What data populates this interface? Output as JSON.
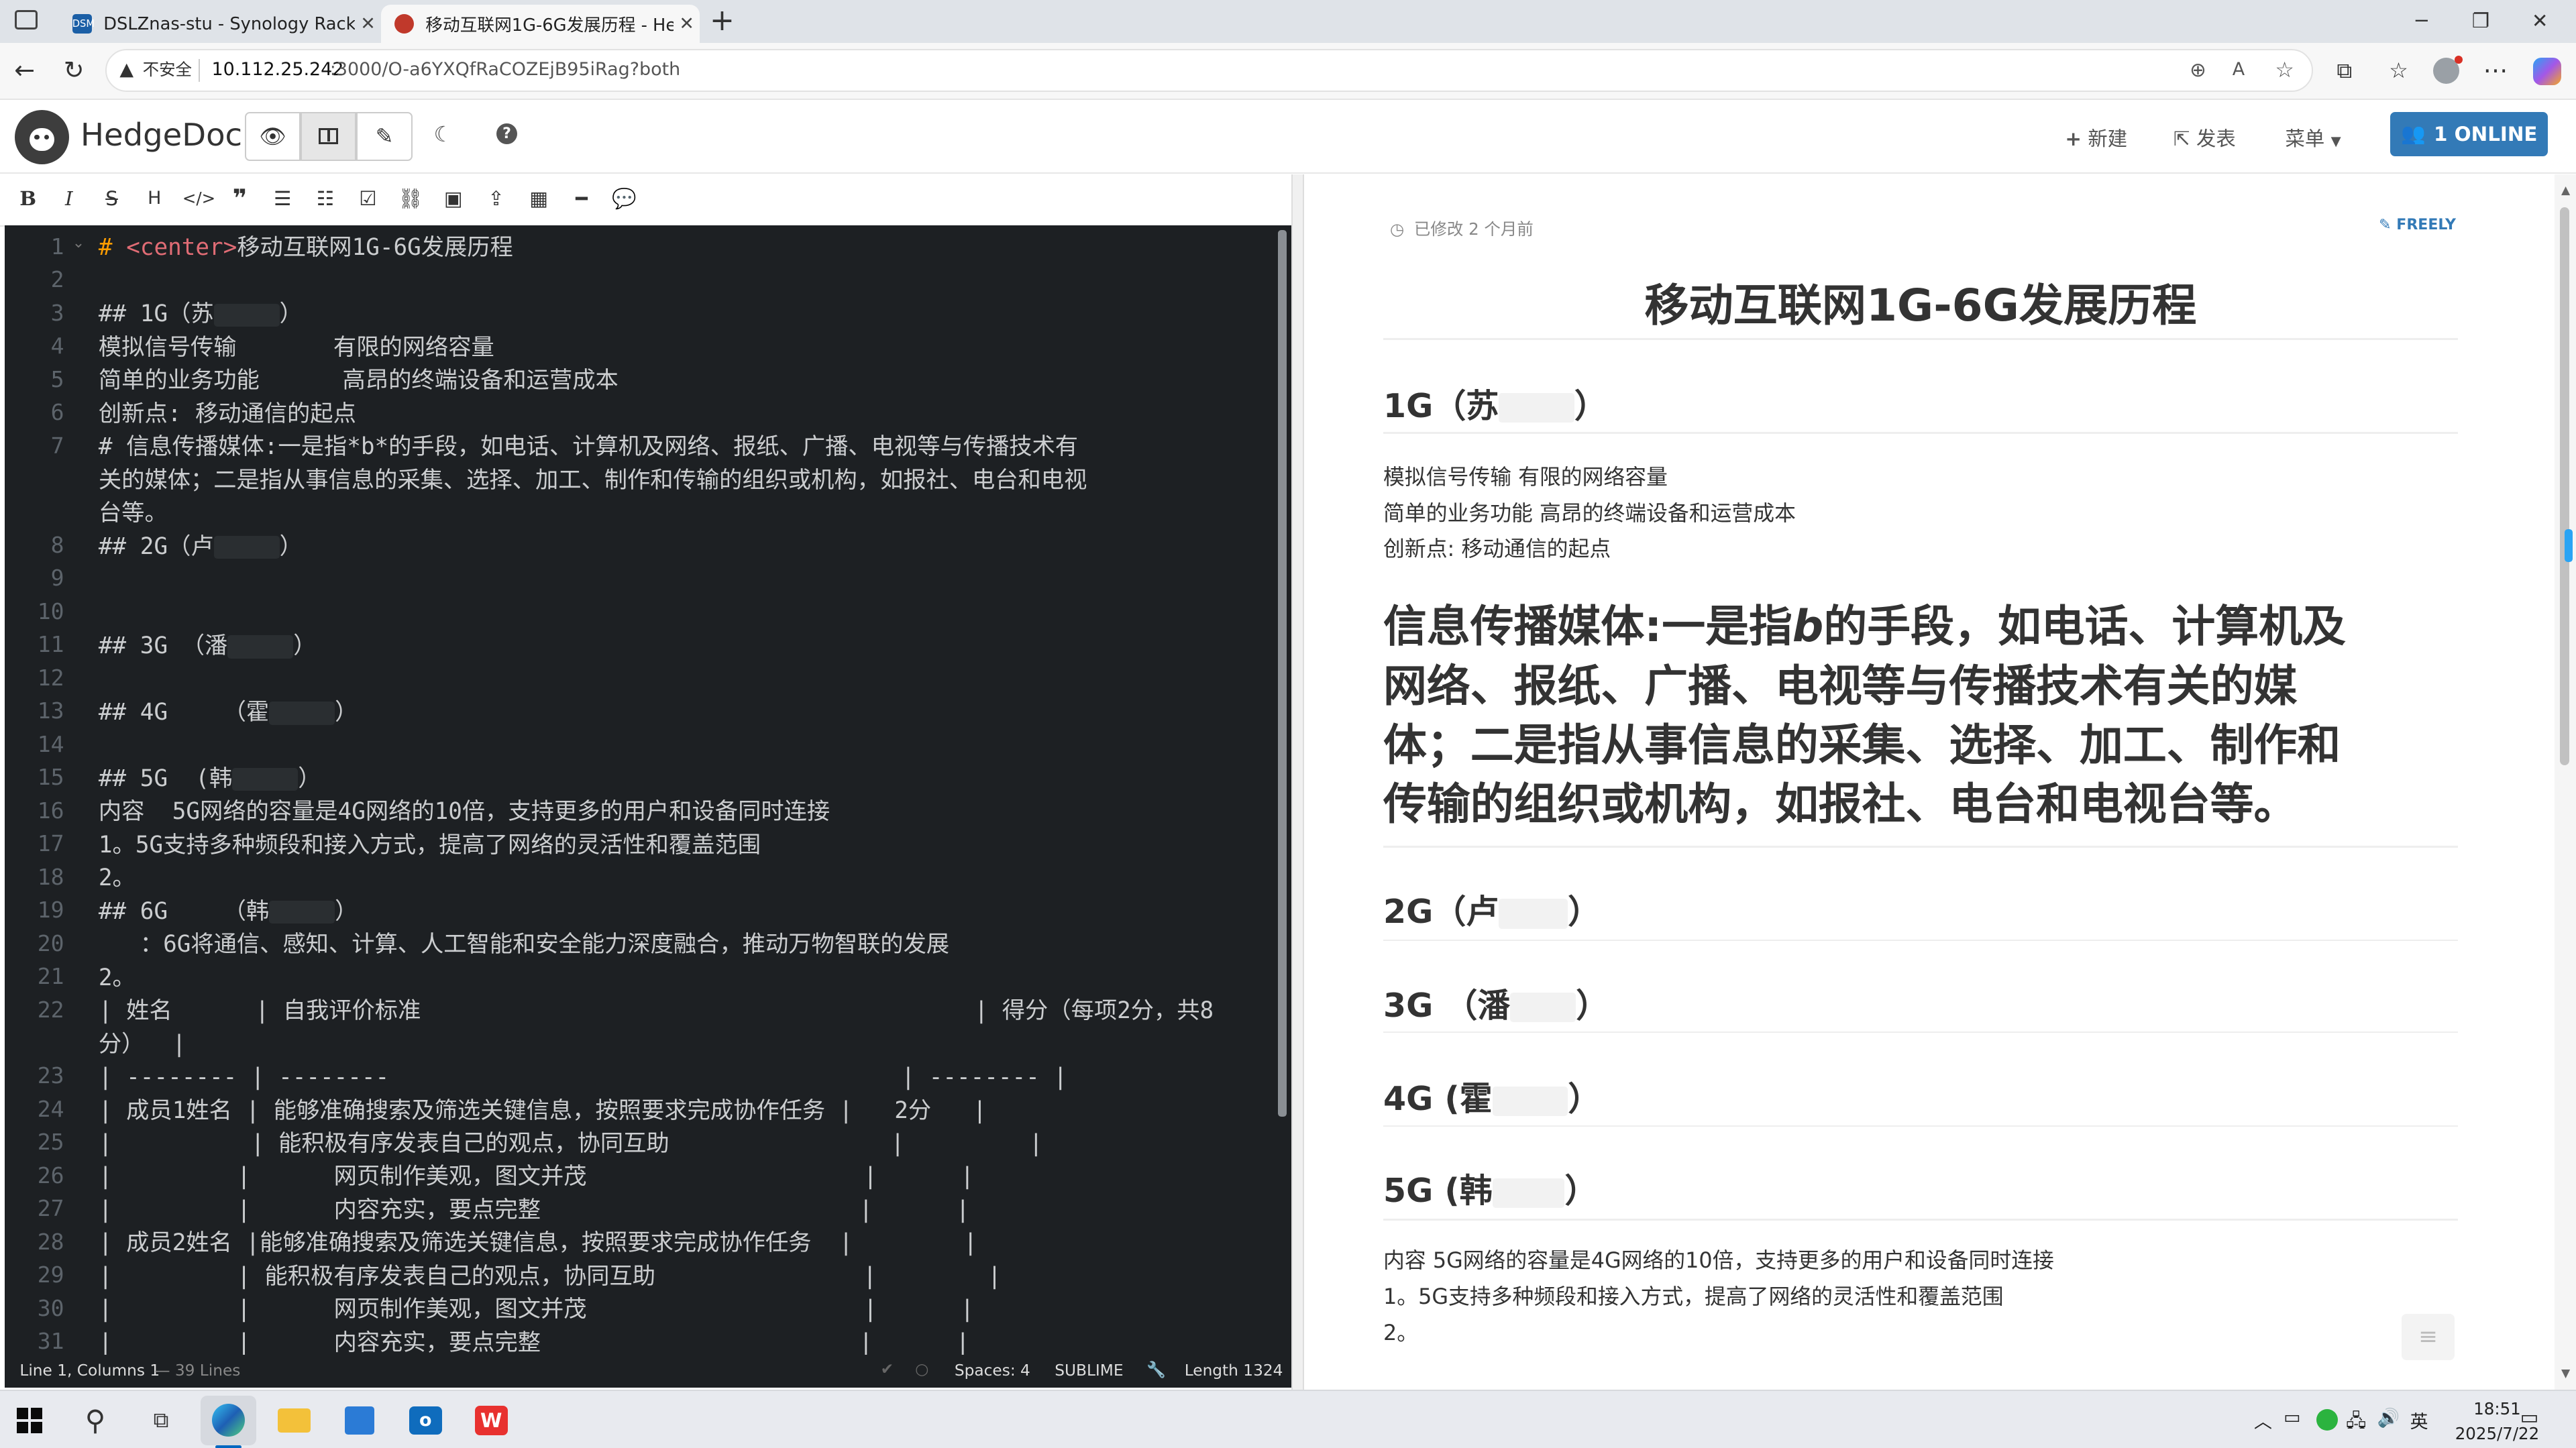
{
  "browser": {
    "tabs": [
      {
        "title": "DSLZnas-stu - Synology RackStati",
        "favicon_label": "DSM",
        "favicon_color": "#1b5fa6"
      },
      {
        "title": "移动互联网1G-6G发展历程 - Hed",
        "favicon_color": "#c0392b"
      }
    ],
    "new_tab": "+",
    "security_label": "不安全",
    "url_host": "10.112.25.242",
    "url_rest": ":3000/O-a6YXQfRaCOZEjB95iRag?both"
  },
  "navbar": {
    "brand": "HedgeDoc",
    "new_label": "新建",
    "publish_label": "发表",
    "menu_label": "菜单",
    "online_label": "1 ONLINE"
  },
  "editor": {
    "lines": [
      {
        "n": "1",
        "segs": [
          {
            "c": "hl",
            "t": "#"
          },
          {
            "t": " "
          },
          {
            "c": "tag",
            "t": "<center>"
          },
          {
            "t": "移动互联网1G-6G发展历程"
          }
        ]
      },
      {
        "n": "2",
        "segs": []
      },
      {
        "n": "3",
        "segs": [
          {
            "t": "## 1G（苏"
          },
          {
            "mask": 40
          },
          {
            "t": "）"
          }
        ]
      },
      {
        "n": "4",
        "segs": [
          {
            "t": "模拟信号传输       有限的网络容量"
          }
        ]
      },
      {
        "n": "5",
        "segs": [
          {
            "t": "简单的业务功能      高昂的终端设备和运营成本"
          }
        ]
      },
      {
        "n": "6",
        "segs": [
          {
            "t": "创新点: 移动通信的起点"
          }
        ]
      },
      {
        "n": "7",
        "segs": [
          {
            "t": "# 信息传播媒体:一是指*b*的手段，如电话、计算机及网络、报纸、广播、电视等与传播技术有"
          }
        ]
      },
      {
        "n": "",
        "segs": [
          {
            "t": "关的媒体；二是指从事信息的采集、选择、加工、制作和传输的组织或机构，如报社、电台和电视"
          }
        ]
      },
      {
        "n": "",
        "segs": [
          {
            "t": "台等。"
          }
        ]
      },
      {
        "n": "8",
        "segs": [
          {
            "t": "## 2G（卢"
          },
          {
            "mask": 40
          },
          {
            "t": "）"
          }
        ]
      },
      {
        "n": "9",
        "segs": []
      },
      {
        "n": "10",
        "segs": []
      },
      {
        "n": "11",
        "segs": [
          {
            "t": "## 3G （潘"
          },
          {
            "mask": 40
          },
          {
            "t": "）"
          }
        ]
      },
      {
        "n": "12",
        "segs": []
      },
      {
        "n": "13",
        "segs": [
          {
            "t": "## 4G    （霍"
          },
          {
            "mask": 40
          },
          {
            "t": "）"
          }
        ]
      },
      {
        "n": "14",
        "segs": []
      },
      {
        "n": "15",
        "segs": [
          {
            "t": "## 5G  (韩"
          },
          {
            "mask": 40
          },
          {
            "t": "）"
          }
        ]
      },
      {
        "n": "16",
        "segs": [
          {
            "t": "内容  5G网络的容量是4G网络的10倍，支持更多的用户和设备同时连接"
          }
        ]
      },
      {
        "n": "17",
        "segs": [
          {
            "t": "1。5G支持多种频段和接入方式，提高了网络的灵活性和覆盖范围"
          }
        ]
      },
      {
        "n": "18",
        "segs": [
          {
            "t": "2。"
          }
        ]
      },
      {
        "n": "19",
        "segs": [
          {
            "t": "## 6G    （韩"
          },
          {
            "mask": 40
          },
          {
            "t": "）"
          }
        ]
      },
      {
        "n": "20",
        "segs": [
          {
            "t": "   ：6G将通信、感知、计算、人工智能和安全能力深度融合，推动万物智联的发展"
          }
        ]
      },
      {
        "n": "21",
        "segs": [
          {
            "t": "2。"
          }
        ]
      },
      {
        "n": "22",
        "segs": [
          {
            "t": "| 姓名      | 自我评价标准                                        | 得分（每项2分，共8"
          }
        ]
      },
      {
        "n": "",
        "segs": [
          {
            "t": "分）  |"
          }
        ]
      },
      {
        "n": "23",
        "segs": [
          {
            "t": "| -------- | --------                                     | -------- |"
          }
        ]
      },
      {
        "n": "24",
        "segs": [
          {
            "t": "| 成员1姓名 | 能够准确搜索及筛选关键信息，按照要求完成协作任务 |   2分   |"
          }
        ]
      },
      {
        "n": "25",
        "segs": [
          {
            "t": "|          | 能积极有序发表自己的观点，协同互助                |         |"
          }
        ]
      },
      {
        "n": "26",
        "segs": [
          {
            "t": "|         |      网页制作美观，图文并茂                    |      |"
          }
        ]
      },
      {
        "n": "27",
        "segs": [
          {
            "t": "|         |      内容充实，要点完整                       |      |"
          }
        ]
      },
      {
        "n": "28",
        "segs": [
          {
            "t": "| 成员2姓名 |能够准确搜索及筛选关键信息，按照要求完成协作任务  |        |"
          }
        ]
      },
      {
        "n": "29",
        "segs": [
          {
            "t": "|         | 能积极有序发表自己的观点，协同互助               |        |"
          }
        ]
      },
      {
        "n": "30",
        "segs": [
          {
            "t": "|         |      网页制作美观，图文并茂                    |      |"
          }
        ]
      },
      {
        "n": "31",
        "segs": [
          {
            "t": "|         |      内容充实，要点完整                       |      |"
          }
        ]
      }
    ]
  },
  "status": {
    "cursor": "Line 1, Columns 1",
    "lines": "— 39 Lines",
    "spaces": "Spaces: 4",
    "keymap": "SUBLIME",
    "length": "Length 1324"
  },
  "preview": {
    "modified": "已修改 2 个月前",
    "freely": "FREELY",
    "title": "移动互联网1G-6G发展历程",
    "h_1g": "1G（苏",
    "p1": "模拟信号传输 有限的网络容量",
    "p2": "简单的业务功能 高昂的终端设备和运营成本",
    "p3": "创新点: 移动通信的起点",
    "big_lines": [
      [
        "信息传播媒体:一是指",
        "b",
        "的手段，如电话、计算机及"
      ],
      [
        "网络、报纸、广播、电视等与传播技术有关的媒"
      ],
      [
        "体；二是指从事信息的采集、选择、加工、制作和"
      ],
      [
        "传输的组织或机构，如报社、电台和电视台等。"
      ]
    ],
    "h_2g": "2G（卢",
    "h_3g": "3G （潘",
    "h_4g": "4G (霍",
    "h_5g": "5G (韩",
    "p5": "内容 5G网络的容量是4G网络的10倍，支持更多的用户和设备同时连接",
    "p6": "1。5G支持多种频段和接入方式，提高了网络的灵活性和覆盖范围",
    "p7": "2。",
    "close_paren": "）"
  },
  "taskbar": {
    "ime": "英",
    "time": "18:51",
    "date": "2025/7/22"
  }
}
